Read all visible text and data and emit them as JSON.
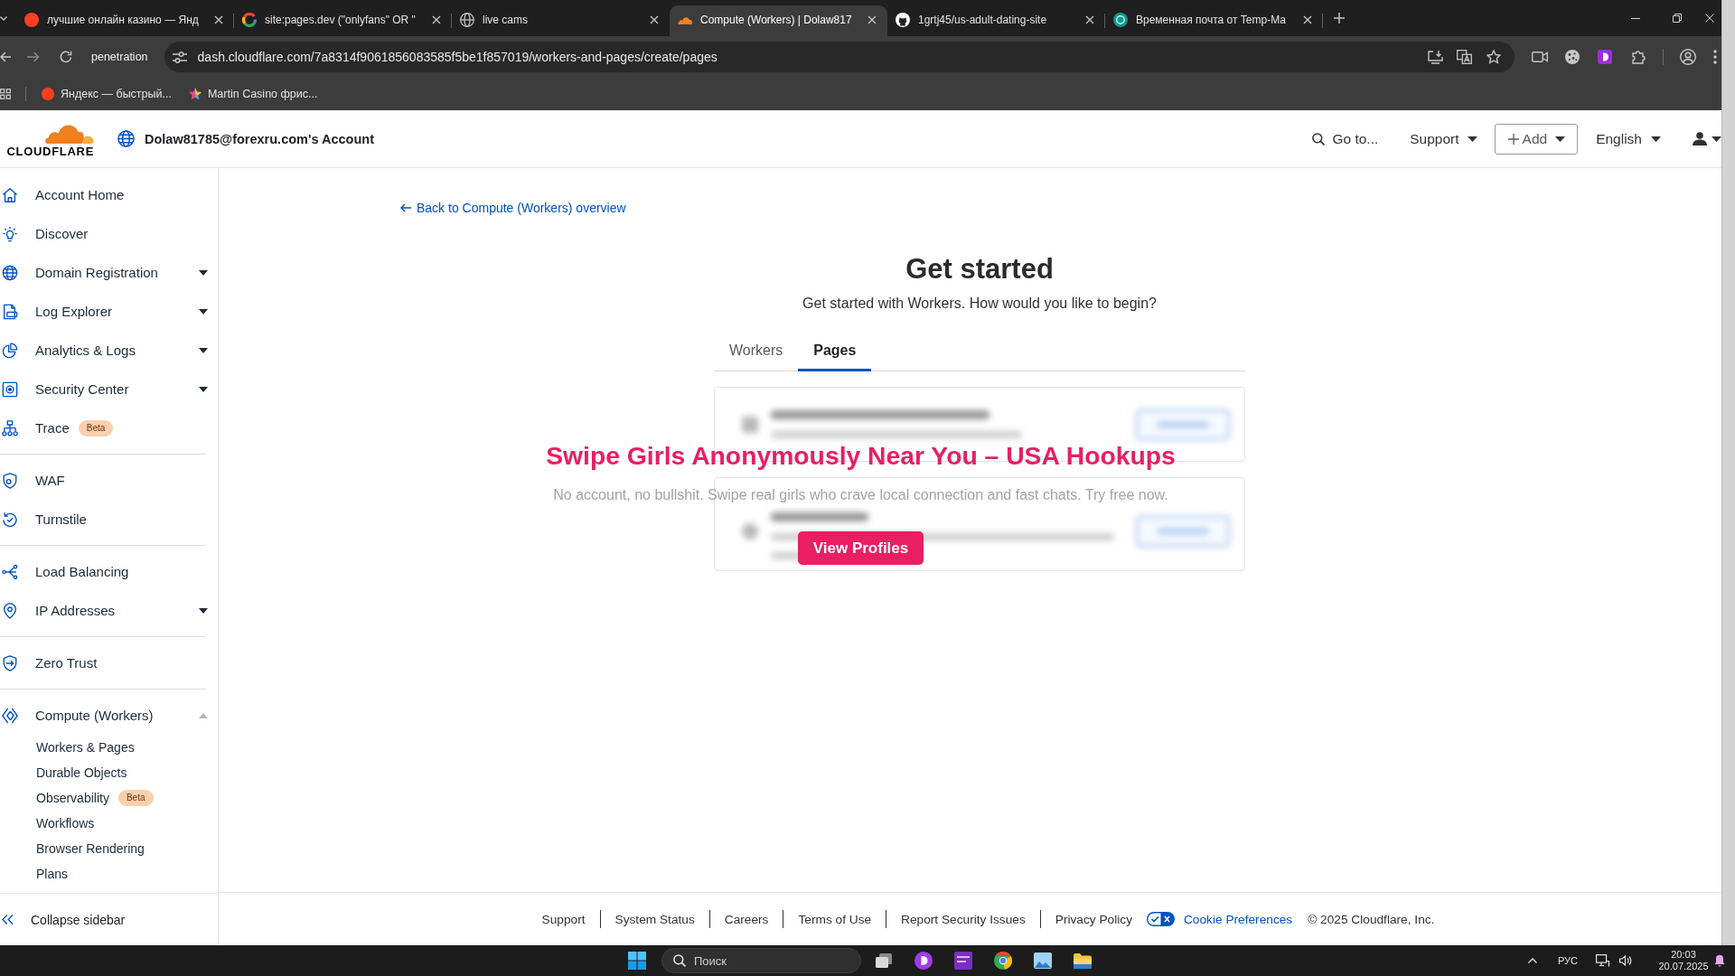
{
  "browser": {
    "tabs": [
      {
        "title": "лучшие онлайн казино — Янд",
        "selected": false
      },
      {
        "title": "site:pages.dev (\"onlyfans\" OR \"",
        "selected": false
      },
      {
        "title": "live cams",
        "selected": false
      },
      {
        "title": "Compute (Workers) | Dolaw817",
        "selected": true
      },
      {
        "title": "1grtj45/us-adult-dating-site",
        "selected": false
      },
      {
        "title": "Временная почта от Temp-Ma",
        "selected": false
      }
    ],
    "profile_label": "penetration",
    "url": "dash.cloudflare.com/7a8314f9061856083585f5be1f857019/workers-and-pages/create/pages",
    "bookmarks": [
      "Яндекс — быстрый...",
      "Martin Casino фрис..."
    ]
  },
  "header": {
    "logo": "CLOUDFLARE",
    "account": "Dolaw81785@forexru.com's Account",
    "search_link": "Go to...",
    "support_menu": "Support",
    "add_button": "Add",
    "language_menu": "English"
  },
  "sidebar": {
    "groups": [
      [
        {
          "label": "Account Home"
        },
        {
          "label": "Discover"
        },
        {
          "label": "Domain Registration",
          "expanded": false
        },
        {
          "label": "Log Explorer",
          "expanded": false
        },
        {
          "label": "Analytics & Logs",
          "expanded": false
        },
        {
          "label": "Security Center",
          "expanded": false
        },
        {
          "label": "Trace",
          "badge": "Beta"
        }
      ],
      [
        {
          "label": "WAF"
        },
        {
          "label": "Turnstile"
        }
      ],
      [
        {
          "label": "Load Balancing"
        },
        {
          "label": "IP Addresses",
          "expanded": false
        }
      ],
      [
        {
          "label": "Zero Trust"
        }
      ],
      [
        {
          "label": "Compute (Workers)",
          "expanded": true,
          "children": [
            {
              "label": "Workers & Pages"
            },
            {
              "label": "Durable Objects"
            },
            {
              "label": "Observability",
              "badge": "Beta"
            },
            {
              "label": "Workflows"
            },
            {
              "label": "Browser Rendering"
            },
            {
              "label": "Plans"
            }
          ]
        }
      ]
    ],
    "collapse": "Collapse sidebar"
  },
  "main": {
    "back_link": "Back to Compute (Workers) overview",
    "title": "Get started",
    "subtitle": "Get started with Workers. How would you like to begin?",
    "tabs": [
      {
        "label": "Workers",
        "selected": false
      },
      {
        "label": "Pages",
        "selected": true
      }
    ]
  },
  "overlay": {
    "headline": "Swipe Girls Anonymously Near You – USA Hookups",
    "text": "No account, no bullshit. Swipe real girls who crave local connection and fast chats. Try free now.",
    "button": "View Profiles"
  },
  "footer": {
    "links": [
      "Support",
      "System Status",
      "Careers",
      "Terms of Use",
      "Report Security Issues",
      "Privacy Policy"
    ],
    "cookie_link": "Cookie Preferences",
    "copyright": "© 2025 Cloudflare, Inc."
  },
  "taskbar": {
    "search": {
      "placeholder": "Поиск"
    },
    "language": "РУС",
    "time": "20:03",
    "date": "20.07.2025"
  }
}
